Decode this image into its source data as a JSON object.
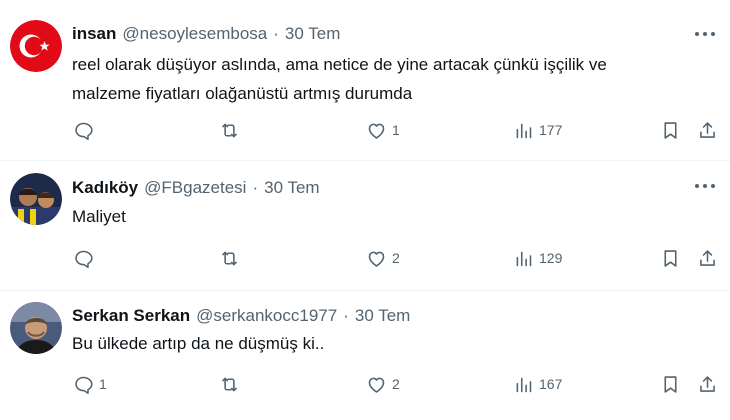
{
  "tweets": [
    {
      "display_name": "insan",
      "handle": "@nesoylesembosa",
      "separator": "·",
      "date": "30 Tem",
      "text_line1": "reel olarak düşüyor aslında,  ama netice de yine artacak çünkü işçilik ve",
      "text_line2": "malzeme fiyatları olağanüstü artmış durumda",
      "replies": "",
      "retweets": "",
      "likes": "1",
      "views": "177",
      "avatar_icon": "turkish-flag-avatar",
      "avatar_color": "#e30a17"
    },
    {
      "display_name": "Kadıköy",
      "handle": "@FBgazetesi",
      "separator": "·",
      "date": "30 Tem",
      "text_line1": "Maliyet",
      "replies": "",
      "retweets": "",
      "likes": "2",
      "views": "129",
      "avatar_icon": "fenerbahce-photo-avatar",
      "avatar_color": "#1e2a4a"
    },
    {
      "display_name": "Serkan Serkan",
      "handle": "@serkankocc1977",
      "separator": "·",
      "date": "30 Tem",
      "text_line1": "Bu ülkede artıp da ne düşmüş ki..",
      "replies": "1",
      "retweets": "",
      "likes": "2",
      "views": "167",
      "avatar_icon": "portrait-photo-avatar",
      "avatar_color": "#4a5a7a"
    }
  ],
  "icons": {
    "more": "more-horizontal-icon",
    "reply": "reply-icon",
    "retweet": "retweet-icon",
    "like": "like-icon",
    "views": "views-icon",
    "bookmark": "bookmark-icon",
    "share": "share-icon"
  },
  "colors": {
    "text": "#0f1419",
    "secondary": "#536471",
    "divider": "#eff3f4",
    "flag_red": "#e30a17"
  }
}
